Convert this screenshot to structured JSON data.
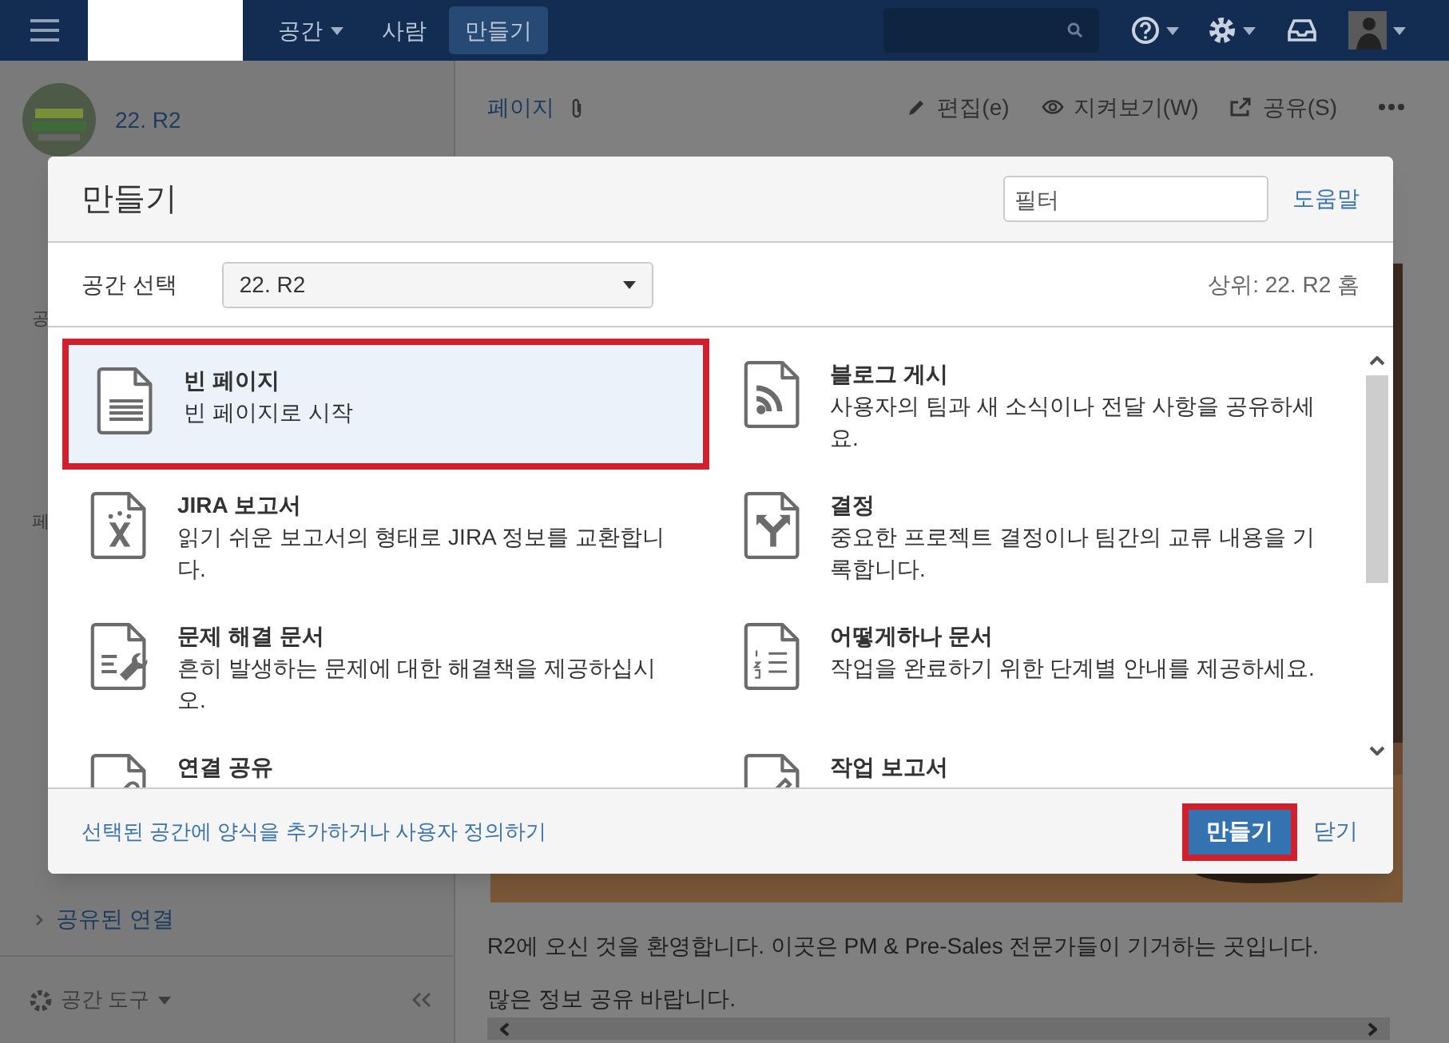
{
  "nav": {
    "items": [
      {
        "label": "공간",
        "dropdown": true,
        "selected": false
      },
      {
        "label": "사람",
        "dropdown": false,
        "selected": false
      },
      {
        "label": "만들기",
        "dropdown": false,
        "selected": true
      }
    ]
  },
  "sidebar": {
    "space_name": "22. R2",
    "fragments": [
      "공",
      "페"
    ],
    "link": "공유된 연결",
    "tools": "공간 도구"
  },
  "content": {
    "tab": "페이지",
    "actions": [
      "편집(e)",
      "지켜보기(W)",
      "공유(S)"
    ],
    "paragraphs": [
      "R2에 오신 것을 환영합니다. 이곳은 PM & Pre-Sales 전문가들이 기거하는 곳입니다.",
      "많은 정보 공유 바랍니다."
    ]
  },
  "dialog": {
    "title": "만들기",
    "filter": {
      "placeholder": "필터"
    },
    "help": "도움말",
    "space_label": "공간 선택",
    "space_value": "22. R2",
    "parent": "상위: 22. R2 홈",
    "templates": [
      {
        "kind": "page",
        "title": "빈 페이지",
        "description": "빈 페이지로 시작",
        "selected": true,
        "annotated": true
      },
      {
        "kind": "blog",
        "title": "블로그 게시",
        "description": "사용자의 팀과 새 소식이나 전달 사항을 공유하세요.",
        "selected": false,
        "annotated": false
      },
      {
        "kind": "jira",
        "title": "JIRA 보고서",
        "description": "읽기 쉬운 보고서의 형태로 JIRA 정보를 교환합니다.",
        "selected": false,
        "annotated": false
      },
      {
        "kind": "decision",
        "title": "결정",
        "description": "중요한 프로젝트 결정이나 팀간의 교류 내용을 기록합니다.",
        "selected": false,
        "annotated": false
      },
      {
        "kind": "troubleshoot",
        "title": "문제 해결 문서",
        "description": "흔히 발생하는 문제에 대한 해결책을 제공하십시오.",
        "selected": false,
        "annotated": false
      },
      {
        "kind": "howto",
        "title": "어떻게하나 문서",
        "description": "작업을 완료하기 위한 단계별 안내를 제공하세요.",
        "selected": false,
        "annotated": false
      },
      {
        "kind": "link",
        "title": "연결 공유",
        "selected": false,
        "annotated": false
      },
      {
        "kind": "task",
        "title": "작업 보고서",
        "selected": false,
        "annotated": false
      }
    ],
    "footer_link": "선택된 공간에 양식을 추가하거나 사용자 정의하기",
    "create_button": {
      "label": "만들기",
      "annotated": true
    },
    "close": "닫기"
  }
}
